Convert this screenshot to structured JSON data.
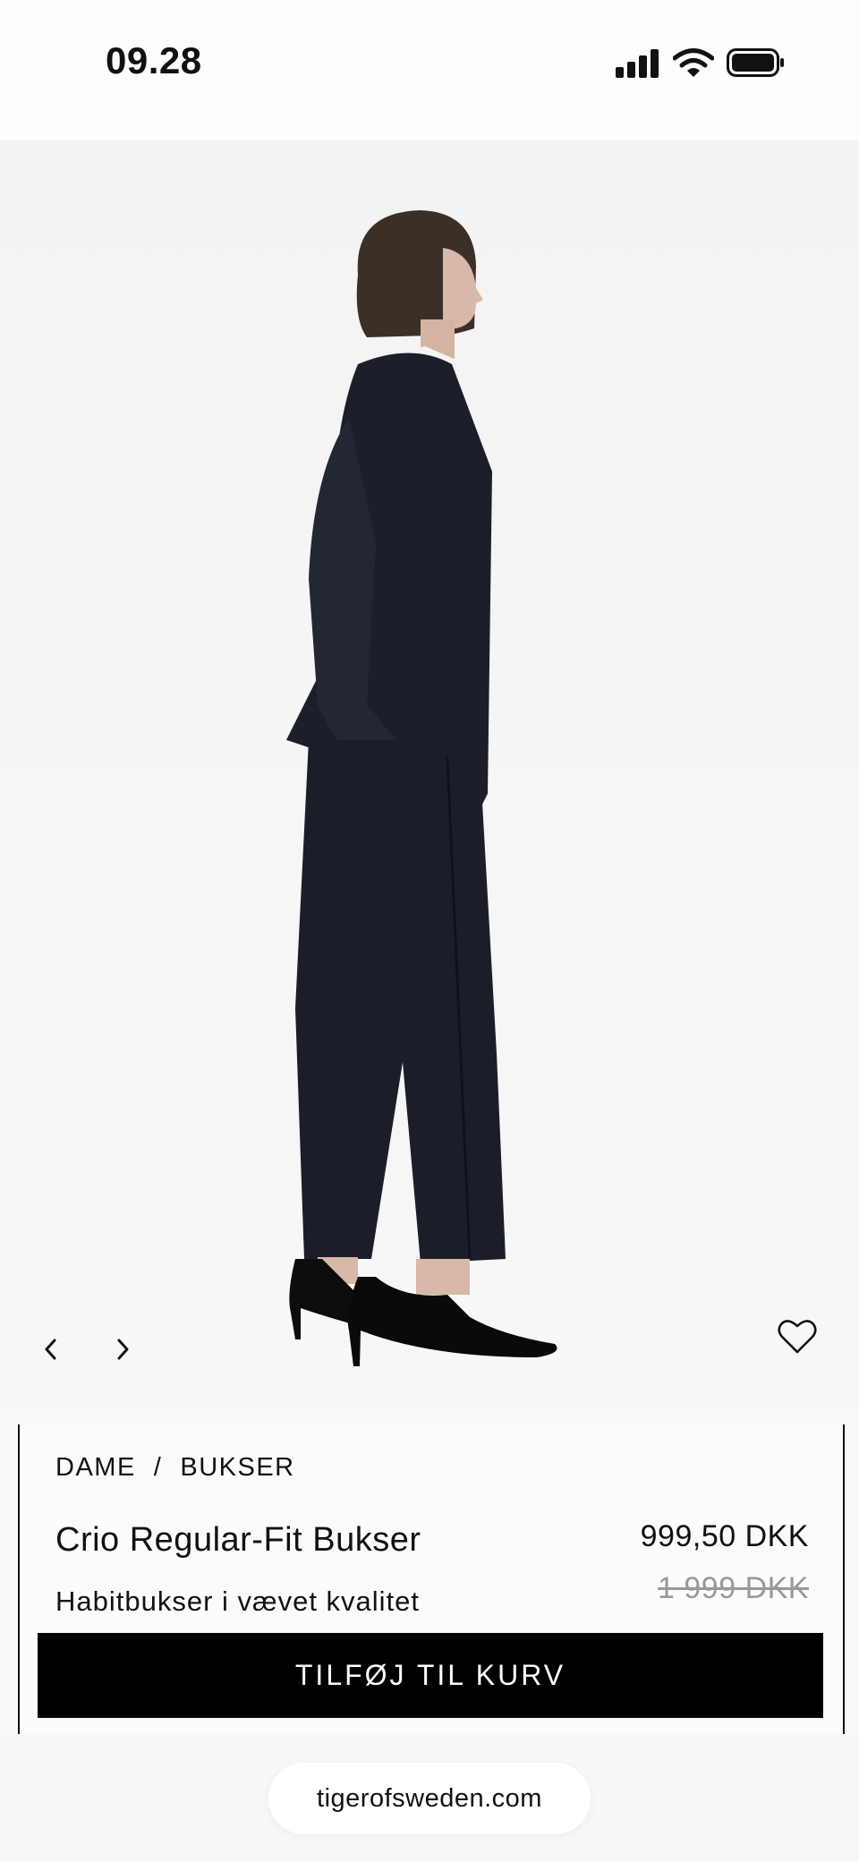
{
  "status_bar": {
    "time": "09.28"
  },
  "product": {
    "breadcrumb": [
      "DAME",
      "BUKSER"
    ],
    "breadcrumb_separator": "/",
    "name": "Crio Regular-Fit Bukser",
    "description": "Habitbukser i vævet kvalitet",
    "price_current": "999,50 DKK",
    "price_original": "1 999 DKK"
  },
  "actions": {
    "add_to_cart_label": "TILFØJ TIL KURV"
  },
  "browser": {
    "url": "tigerofsweden.com"
  },
  "icons": {
    "prev": "chevron-left-icon",
    "next": "chevron-right-icon",
    "wishlist": "heart-icon",
    "signal": "cellular-signal-icon",
    "wifi": "wifi-icon",
    "battery": "battery-icon"
  },
  "colors": {
    "button_bg": "#000000",
    "button_text": "#ffffff",
    "old_price": "#999999",
    "suit": "#1c1f2a"
  }
}
